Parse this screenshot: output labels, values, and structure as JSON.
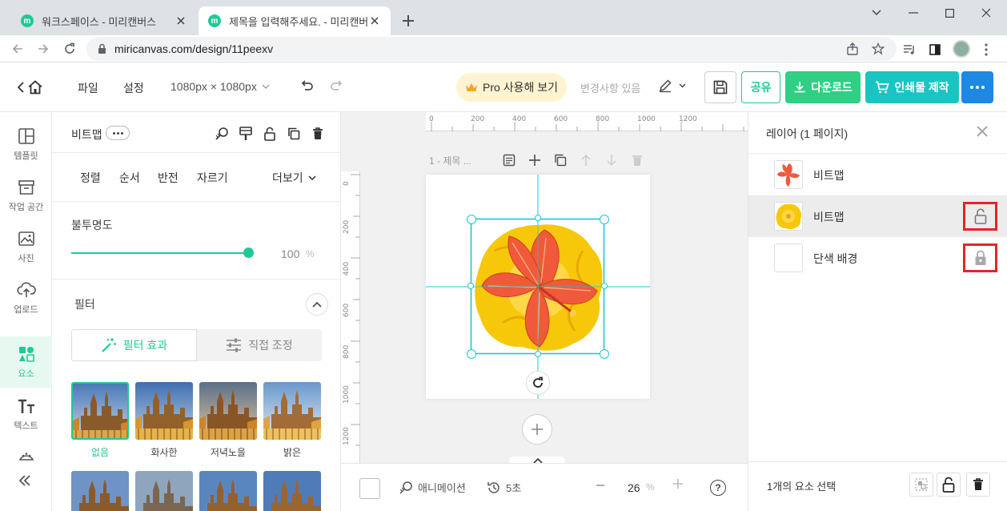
{
  "browser": {
    "tabs": [
      {
        "title": "워크스페이스 - 미리캔버스",
        "active": false
      },
      {
        "title": "제목을 입력해주세요. - 미리캔버",
        "active": true
      }
    ],
    "favicon_letter": "m",
    "url": "miricanvas.com/design/11peexv"
  },
  "header": {
    "menu": [
      "파일",
      "설정"
    ],
    "size_label": "1080px × 1080px",
    "pro_label": "Pro 사용해 보기",
    "changes_label": "변경사항 있음",
    "share_label": "공유",
    "download_label": "다운로드",
    "print_label": "인쇄물 제작"
  },
  "rail": {
    "items": [
      {
        "label": "템플릿",
        "icon": "template-icon",
        "active": false
      },
      {
        "label": "작업 공간",
        "icon": "workspace-icon",
        "active": false
      },
      {
        "label": "사진",
        "icon": "photo-icon",
        "active": false
      },
      {
        "label": "업로드",
        "icon": "upload-icon",
        "active": false
      },
      {
        "label": "요소",
        "icon": "elements-icon",
        "active": true
      },
      {
        "label": "텍스트",
        "icon": "text-icon",
        "active": false
      },
      {
        "label": "",
        "icon": "theme-icon",
        "active": false
      }
    ]
  },
  "properties": {
    "title": "비트맵",
    "actions": [
      "정렬",
      "순서",
      "반전",
      "자르기"
    ],
    "more_label": "더보기",
    "opacity_label": "불투명도",
    "opacity_value": "100",
    "opacity_unit": "%",
    "opacity_level": 1.0,
    "filter_label": "필터",
    "filter_tabs": [
      "필터 효과",
      "직접 조정"
    ],
    "filters": [
      {
        "label": "없음",
        "selected": true
      },
      {
        "label": "화사한",
        "selected": false
      },
      {
        "label": "저녁노을",
        "selected": false
      },
      {
        "label": "밝은",
        "selected": false
      }
    ]
  },
  "canvas": {
    "page_title": "1 - 제목 ...",
    "ruler_h": [
      "0",
      "200",
      "400",
      "600",
      "800",
      "1000",
      "1200"
    ],
    "ruler_v": [
      "0",
      "200",
      "400",
      "600",
      "800",
      "1000",
      "1200"
    ]
  },
  "bottom": {
    "animation_label": "애니메이션",
    "duration_label": "5초",
    "zoom_value": "26",
    "zoom_unit": "%",
    "help_label": "?"
  },
  "layers": {
    "title": "레이어 (1 페이지)",
    "rows": [
      {
        "name": "비트맵",
        "thumb": "hibiscus",
        "selected": false,
        "lock": ""
      },
      {
        "name": "비트맵",
        "thumb": "yellow-flower",
        "selected": true,
        "lock": "unlocked"
      },
      {
        "name": "단색 배경",
        "thumb": "blank",
        "selected": false,
        "lock": "locked"
      }
    ],
    "selection_label": "1개의 요소 선택"
  },
  "colors": {
    "accent_green": "#20c997",
    "download_green": "#2fcf84",
    "print_teal": "#18c5c2",
    "more_blue": "#1e88e5",
    "highlight_red": "#e8232a",
    "selection_cyan": "#1ec8d0"
  }
}
